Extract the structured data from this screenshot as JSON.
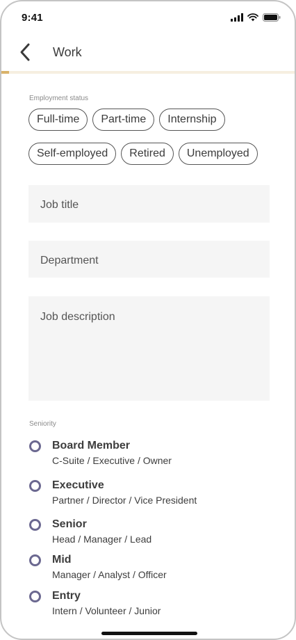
{
  "status_bar": {
    "time": "9:41",
    "icons": [
      "signal-icon",
      "wifi-icon",
      "battery-icon"
    ]
  },
  "header": {
    "title": "Work",
    "back_icon": "chevron-left-icon",
    "progress_fraction": 0.025,
    "progress_color": "#d9b36a"
  },
  "employment_status": {
    "label": "Employment status",
    "options_row1": [
      "Full-time",
      "Part-time",
      "Internship"
    ],
    "options_row2": [
      "Self-employed",
      "Retired",
      "Unemployed"
    ]
  },
  "fields": {
    "job_title": "Job title",
    "department": "Department",
    "job_description": "Job description"
  },
  "seniority": {
    "label": "Seniority",
    "options": [
      {
        "title": "Board Member",
        "subtitle": "C-Suite / Executive / Owner"
      },
      {
        "title": "Executive",
        "subtitle": "Partner / Director / Vice President"
      },
      {
        "title": "Senior",
        "subtitle": "Head / Manager / Lead"
      },
      {
        "title": "Mid",
        "subtitle": "Manager / Analyst / Officer"
      },
      {
        "title": "Entry",
        "subtitle": "Intern / Volunteer / Junior"
      }
    ]
  },
  "colors": {
    "radio": "#6b6890",
    "field_bg": "#f5f5f5",
    "chip_border": "#555555"
  }
}
